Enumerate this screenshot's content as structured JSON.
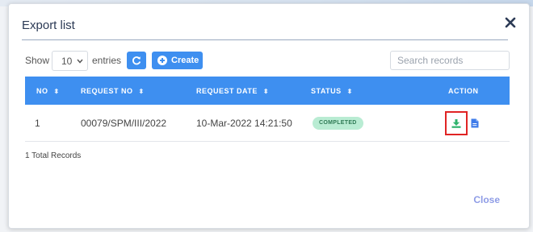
{
  "modal": {
    "title": "Export list",
    "close_link": "Close"
  },
  "controls": {
    "show_label": "Show",
    "entries_value": "10",
    "entries_label": "entries",
    "create_label": "Create",
    "search_placeholder": "Search records"
  },
  "table": {
    "columns": [
      "NO",
      "REQUEST NO",
      "REQUEST DATE",
      "STATUS",
      "ACTION"
    ],
    "rows": [
      {
        "no": "1",
        "request_no": "00079/SPM/III/2022",
        "request_date": "10-Mar-2022 14:21:50",
        "status": "COMPLETED"
      }
    ]
  },
  "footer": {
    "total_records": "1 Total Records"
  },
  "colors": {
    "accent": "#3e8ff0",
    "status_completed_bg": "#b9ecd3",
    "status_completed_text": "#2f7a55",
    "download_icon": "#2fb36d",
    "highlight_border": "#e02424",
    "close_link": "#8e9ce6"
  },
  "icons": {
    "close": "close-icon",
    "refresh": "refresh-icon",
    "create": "plus-circle-icon",
    "sort": "sort-icon",
    "download": "download-icon",
    "document": "document-icon",
    "dropdown": "chevron-down-icon"
  }
}
